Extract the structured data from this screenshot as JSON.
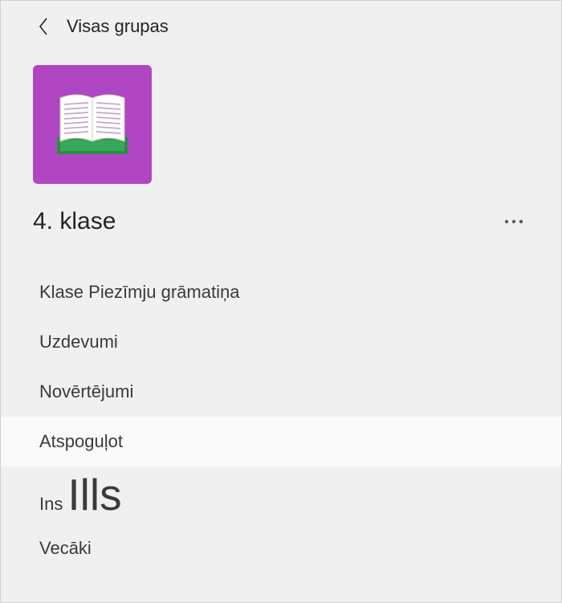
{
  "header": {
    "back_label": "Visas grupas"
  },
  "team": {
    "title": "4. klase",
    "avatar_color": "#b146c2"
  },
  "nav": {
    "items": [
      {
        "label": "Klase Piezīmju grāmatiņa",
        "selected": false
      },
      {
        "label": "Uzdevumi",
        "selected": false
      },
      {
        "label": "Novērtējumi",
        "selected": false
      },
      {
        "label": "Atspoguļot",
        "selected": true
      },
      {
        "label_prefix": "Ins",
        "label_overlay": "Ills",
        "selected": false
      },
      {
        "label": "Vecāki",
        "selected": false
      }
    ]
  }
}
